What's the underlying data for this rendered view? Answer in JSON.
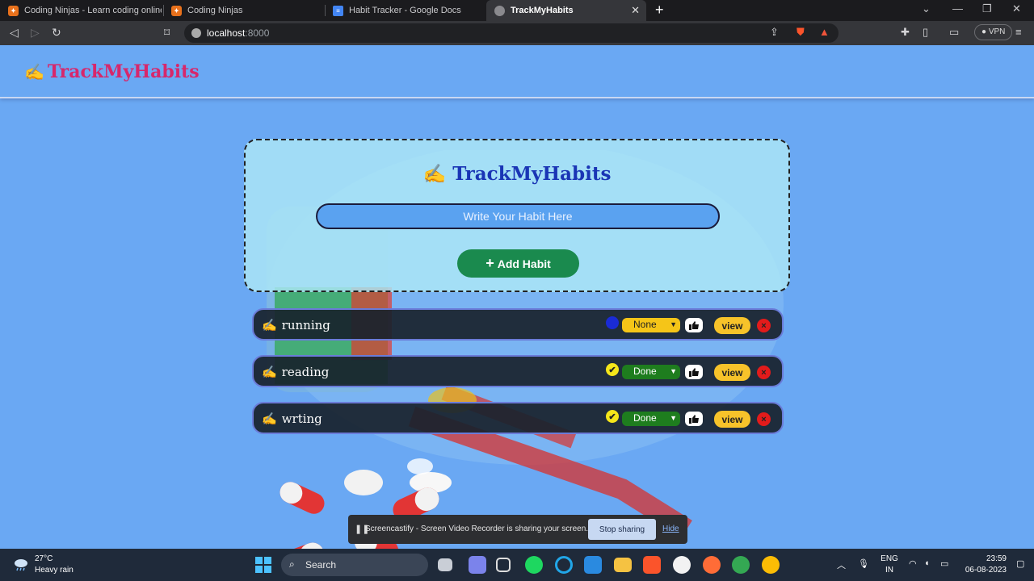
{
  "browser": {
    "tabs": [
      {
        "title": "Coding Ninjas - Learn coding online a",
        "icon": "coding-ninjas-favicon",
        "active": false
      },
      {
        "title": "Coding Ninjas",
        "icon": "coding-ninjas-favicon",
        "active": false
      },
      {
        "title": "Habit Tracker - Google Docs",
        "icon": "google-docs-favicon",
        "active": false
      },
      {
        "title": "TrackMyHabits",
        "icon": "globe-favicon",
        "active": true
      }
    ],
    "url_host": "localhost",
    "url_port": ":8000",
    "vpn_label": "VPN"
  },
  "header": {
    "brand_emoji": "✍️",
    "brand_name": "TrackMyHabits"
  },
  "form": {
    "title_emoji": "✍️",
    "title": "TrackMyHabits",
    "input_placeholder": "Write Your Habit Here",
    "input_value": "",
    "add_button_icon": "+",
    "add_button_label": "Add Habit"
  },
  "habits": [
    {
      "emoji": "✍️",
      "name": "running",
      "status": "None",
      "status_icon": "blue-dot",
      "view_label": "view",
      "delete_icon": "×"
    },
    {
      "emoji": "✍️",
      "name": "reading",
      "status": "Done",
      "status_icon": "✔",
      "view_label": "view",
      "delete_icon": "×"
    },
    {
      "emoji": "✍️",
      "name": "wrting",
      "status": "Done",
      "status_icon": "✔",
      "view_label": "view",
      "delete_icon": "×"
    }
  ],
  "share_bar": {
    "message": "Screencastify - Screen Video Recorder is sharing your screen.",
    "stop_label": "Stop sharing",
    "hide_label": "Hide"
  },
  "taskbar": {
    "temperature": "27°C",
    "weather": "Heavy rain",
    "search_label": "Search",
    "lang_1": "ENG",
    "lang_2": "IN",
    "time": "23:59",
    "date": "06-08-2023"
  },
  "colors": {
    "page_bg": "#6aa8f3",
    "brand": "#d7276b",
    "card_title": "#1a35b5",
    "add_button": "#1a8a4e",
    "view_button": "#f7c32a",
    "status_none": "#f5c518",
    "status_done": "#1e7d1e",
    "delete": "#e21b1b"
  }
}
